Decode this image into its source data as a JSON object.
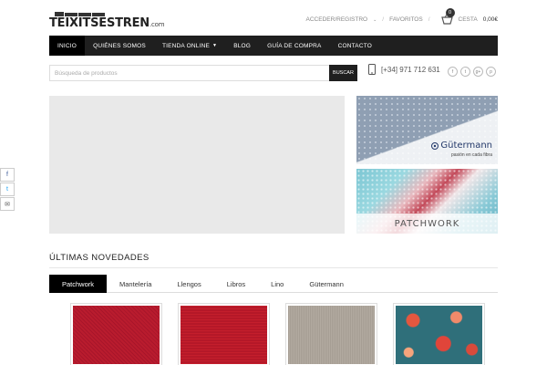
{
  "brand": {
    "logo_text": "TEIXITSESTREN",
    "logo_tld": ".com"
  },
  "header": {
    "account_link": "ACCEDER/REGISTRO",
    "favorites_link": "FAVORITOS",
    "cart_label": "CESTA",
    "cart_total": "0,00€",
    "cart_count": "0"
  },
  "nav": {
    "items": [
      {
        "label": "INICIO",
        "active": true
      },
      {
        "label": "QUIÉNES SOMOS"
      },
      {
        "label": "TIENDA ONLINE",
        "dropdown": true
      },
      {
        "label": "BLOG"
      },
      {
        "label": "GUÍA DE COMPRA"
      },
      {
        "label": "CONTACTO"
      }
    ]
  },
  "search": {
    "placeholder": "Búsqueda de productos",
    "button_label": "BUSCAR"
  },
  "contact": {
    "phone": "[+34] 971 712 631"
  },
  "social_top": [
    {
      "icon": "facebook-icon",
      "glyph": "f"
    },
    {
      "icon": "twitter-icon",
      "glyph": "t"
    },
    {
      "icon": "google-plus-icon",
      "glyph": "g+"
    },
    {
      "icon": "pinterest-icon",
      "glyph": "p"
    }
  ],
  "banners": {
    "gutermann_brand": "Gütermann",
    "gutermann_tagline": "pasión en cada fibra",
    "patchwork_label": "PATCHWORK"
  },
  "social_side": [
    {
      "icon": "facebook-icon",
      "glyph": "f",
      "color": "#3b5998"
    },
    {
      "icon": "twitter-icon",
      "glyph": "t",
      "color": "#1da1f2"
    },
    {
      "icon": "email-icon",
      "glyph": "✉",
      "color": "#555555"
    }
  ],
  "latest": {
    "title": "ÚLTIMAS NOVEDADES",
    "tabs": [
      {
        "label": "Patchwork",
        "active": true
      },
      {
        "label": "Mantelería"
      },
      {
        "label": "Llengos"
      },
      {
        "label": "Libros"
      },
      {
        "label": "Lino"
      },
      {
        "label": "Gütermann"
      }
    ],
    "products": [
      {
        "swatch": "red-fabric",
        "color": "#b0182a"
      },
      {
        "swatch": "red-fabric",
        "color": "#c41f2c"
      },
      {
        "swatch": "grey-linen",
        "color": "#a69e94"
      },
      {
        "swatch": "floral-print",
        "color": "#2f6f7a"
      }
    ]
  },
  "colors": {
    "nav_bg": "#1f1f1f",
    "accent": "#000000"
  }
}
